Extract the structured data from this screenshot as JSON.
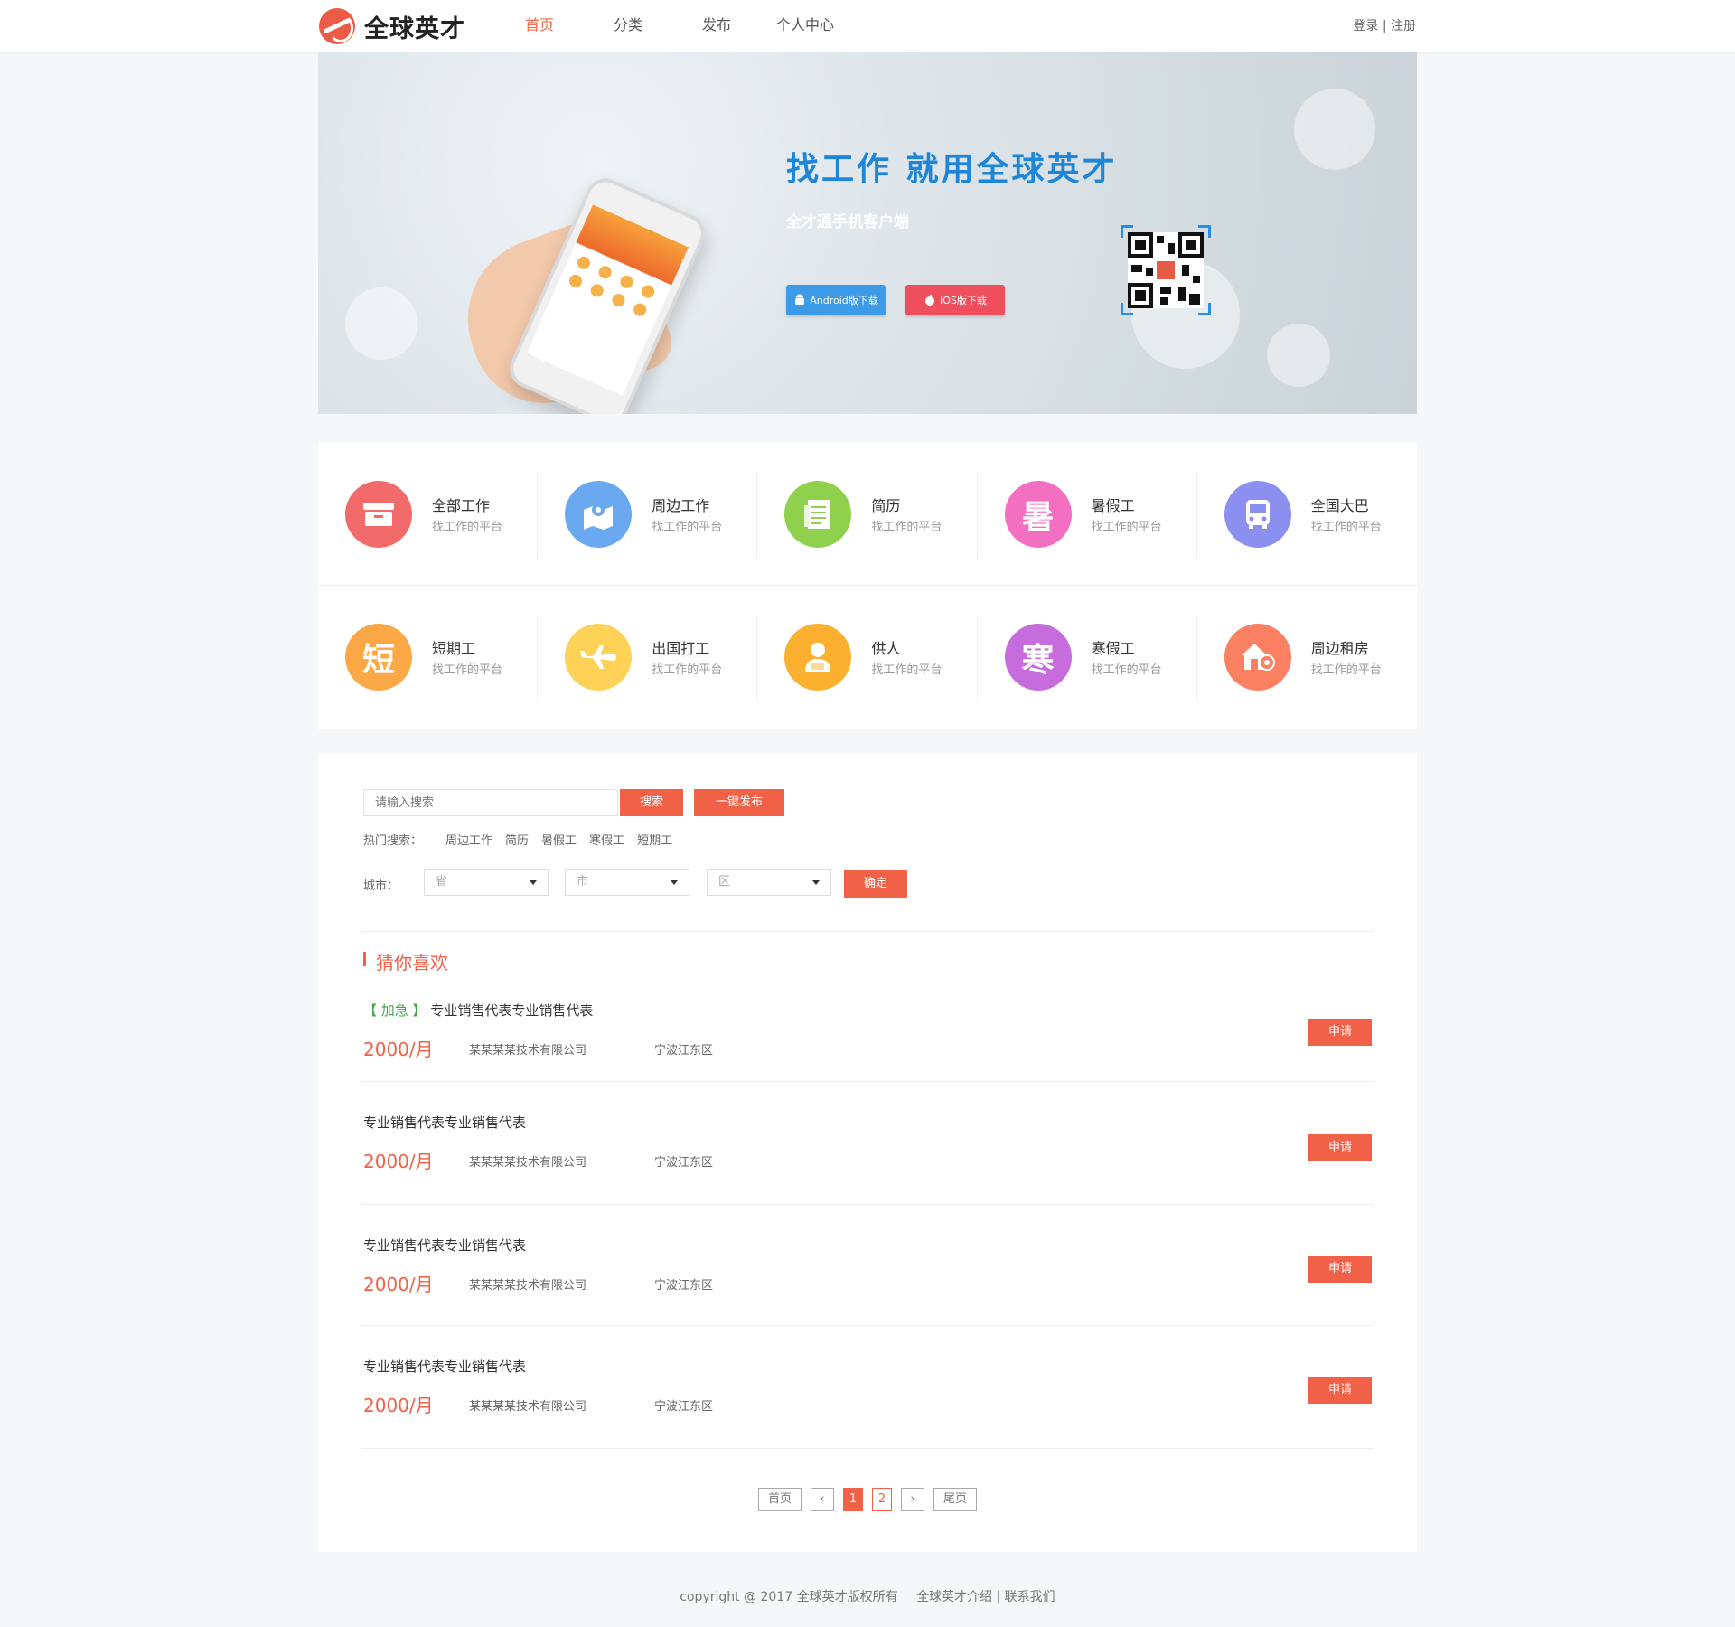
{
  "header": {
    "logo_text": "全球英才",
    "nav": [
      "首页",
      "分类",
      "发布",
      "个人中心"
    ],
    "login": "登录",
    "register": "注册",
    "separator": "|"
  },
  "banner": {
    "title": "找工作 就用全球英才",
    "subtitle": "全才通手机客户端",
    "android_label": "Android版下载",
    "ios_label": "iOS版下载"
  },
  "categories": [
    {
      "title": "全部工作",
      "desc": "找工作的平台",
      "color": "#f26b6b",
      "icon": "briefcase-icon",
      "glyph": "▭"
    },
    {
      "title": "周边工作",
      "desc": "找工作的平台",
      "color": "#6aa9f0",
      "icon": "map-pin-icon",
      "glyph": "⌖"
    },
    {
      "title": "简历",
      "desc": "找工作的平台",
      "color": "#8fd14c",
      "icon": "document-icon",
      "glyph": "≣"
    },
    {
      "title": "暑假工",
      "desc": "找工作的平台",
      "color": "#f36fc2",
      "icon": "summer-char-icon",
      "glyph": "暑"
    },
    {
      "title": "全国大巴",
      "desc": "找工作的平台",
      "color": "#8a8ff0",
      "icon": "bus-icon",
      "glyph": "⌂"
    },
    {
      "title": "短期工",
      "desc": "找工作的平台",
      "color": "#fda847",
      "icon": "short-char-icon",
      "glyph": "短"
    },
    {
      "title": "出国打工",
      "desc": "找工作的平台",
      "color": "#fed256",
      "icon": "airplane-icon",
      "glyph": "✈"
    },
    {
      "title": "供人",
      "desc": "找工作的平台",
      "color": "#fbb12f",
      "icon": "person-icon",
      "glyph": "●"
    },
    {
      "title": "寒假工",
      "desc": "找工作的平台",
      "color": "#c66cdc",
      "icon": "winter-char-icon",
      "glyph": "寒"
    },
    {
      "title": "周边租房",
      "desc": "找工作的平台",
      "color": "#fc8163",
      "icon": "house-key-icon",
      "glyph": "⌂"
    }
  ],
  "search": {
    "placeholder": "请输入搜索",
    "search_btn": "搜索",
    "publish_btn": "一键发布",
    "hot_label": "热门搜索：",
    "hot_keywords": [
      "周边工作",
      "简历",
      "暑假工",
      "寒假工",
      "短期工"
    ],
    "city_label": "城市：",
    "province": "省",
    "city": "市",
    "district": "区",
    "confirm_btn": "确定"
  },
  "recommend": {
    "title": "猜你喜欢",
    "apply_label": "申请",
    "jobs": [
      {
        "urgent": "【 加急 】",
        "title": "专业销售代表专业销售代表",
        "salary": "2000/月",
        "company": "某某某某技术有限公司",
        "location": "宁波江东区"
      },
      {
        "urgent": "",
        "title": "专业销售代表专业销售代表",
        "salary": "2000/月",
        "company": "某某某某技术有限公司",
        "location": "宁波江东区"
      },
      {
        "urgent": "",
        "title": "专业销售代表专业销售代表",
        "salary": "2000/月",
        "company": "某某某某技术有限公司",
        "location": "宁波江东区"
      },
      {
        "urgent": "",
        "title": "专业销售代表专业销售代表",
        "salary": "2000/月",
        "company": "某某某某技术有限公司",
        "location": "宁波江东区"
      }
    ]
  },
  "pager": {
    "first": "首页",
    "prev": "‹",
    "pages": [
      "1",
      "2"
    ],
    "next": "›",
    "last": "尾页"
  },
  "footer": {
    "copyright": "copyright @ 2017 全球英才版权所有",
    "links": "全球英才介绍 | 联系我们"
  },
  "colors": {
    "accent": "#f06148",
    "brand_blue": "#1e86d8",
    "urgent_green": "#3fa44a"
  }
}
